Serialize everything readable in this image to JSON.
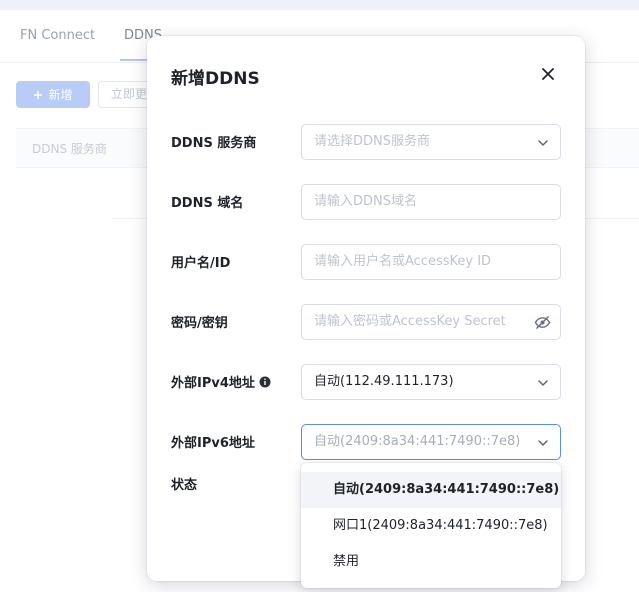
{
  "page": {
    "tabs": [
      {
        "label": "FN Connect"
      },
      {
        "label": "DDNS"
      }
    ],
    "new_button_icon": "plus-icon",
    "new_button_label": "新增",
    "refresh_button_label": "立即更",
    "table_header": "DDNS 服务商"
  },
  "modal": {
    "title": "新增DDNS",
    "close_icon": "close-icon",
    "fields": {
      "provider": {
        "label": "DDNS 服务商",
        "placeholder": "请选择DDNS服务商"
      },
      "domain": {
        "label": "DDNS 域名",
        "placeholder": "请输入DDNS域名"
      },
      "username": {
        "label": "用户名/ID",
        "placeholder": "请输入用户名或AccessKey ID"
      },
      "password": {
        "label": "密码/密钥",
        "placeholder": "请输入密码或AccessKey Secret",
        "icon": "eye-off-icon"
      },
      "ipv4": {
        "label": "外部IPv4地址",
        "value": "自动(112.49.111.173)",
        "icon": "info-icon"
      },
      "ipv6": {
        "label": "外部IPv6地址",
        "value": "自动(2409:8a34:441:7490::7e8)"
      },
      "status": {
        "label": "状态"
      }
    },
    "ipv6_options": [
      {
        "label": "自动(2409:8a34:441:7490::7e8)",
        "selected": true
      },
      {
        "label": "网口1(2409:8a34:441:7490::7e8)",
        "selected": false
      },
      {
        "label": "禁用",
        "selected": false
      }
    ]
  },
  "colors": {
    "accent": "#5b8def",
    "primary_button_disabled": "#b9ccf7"
  }
}
